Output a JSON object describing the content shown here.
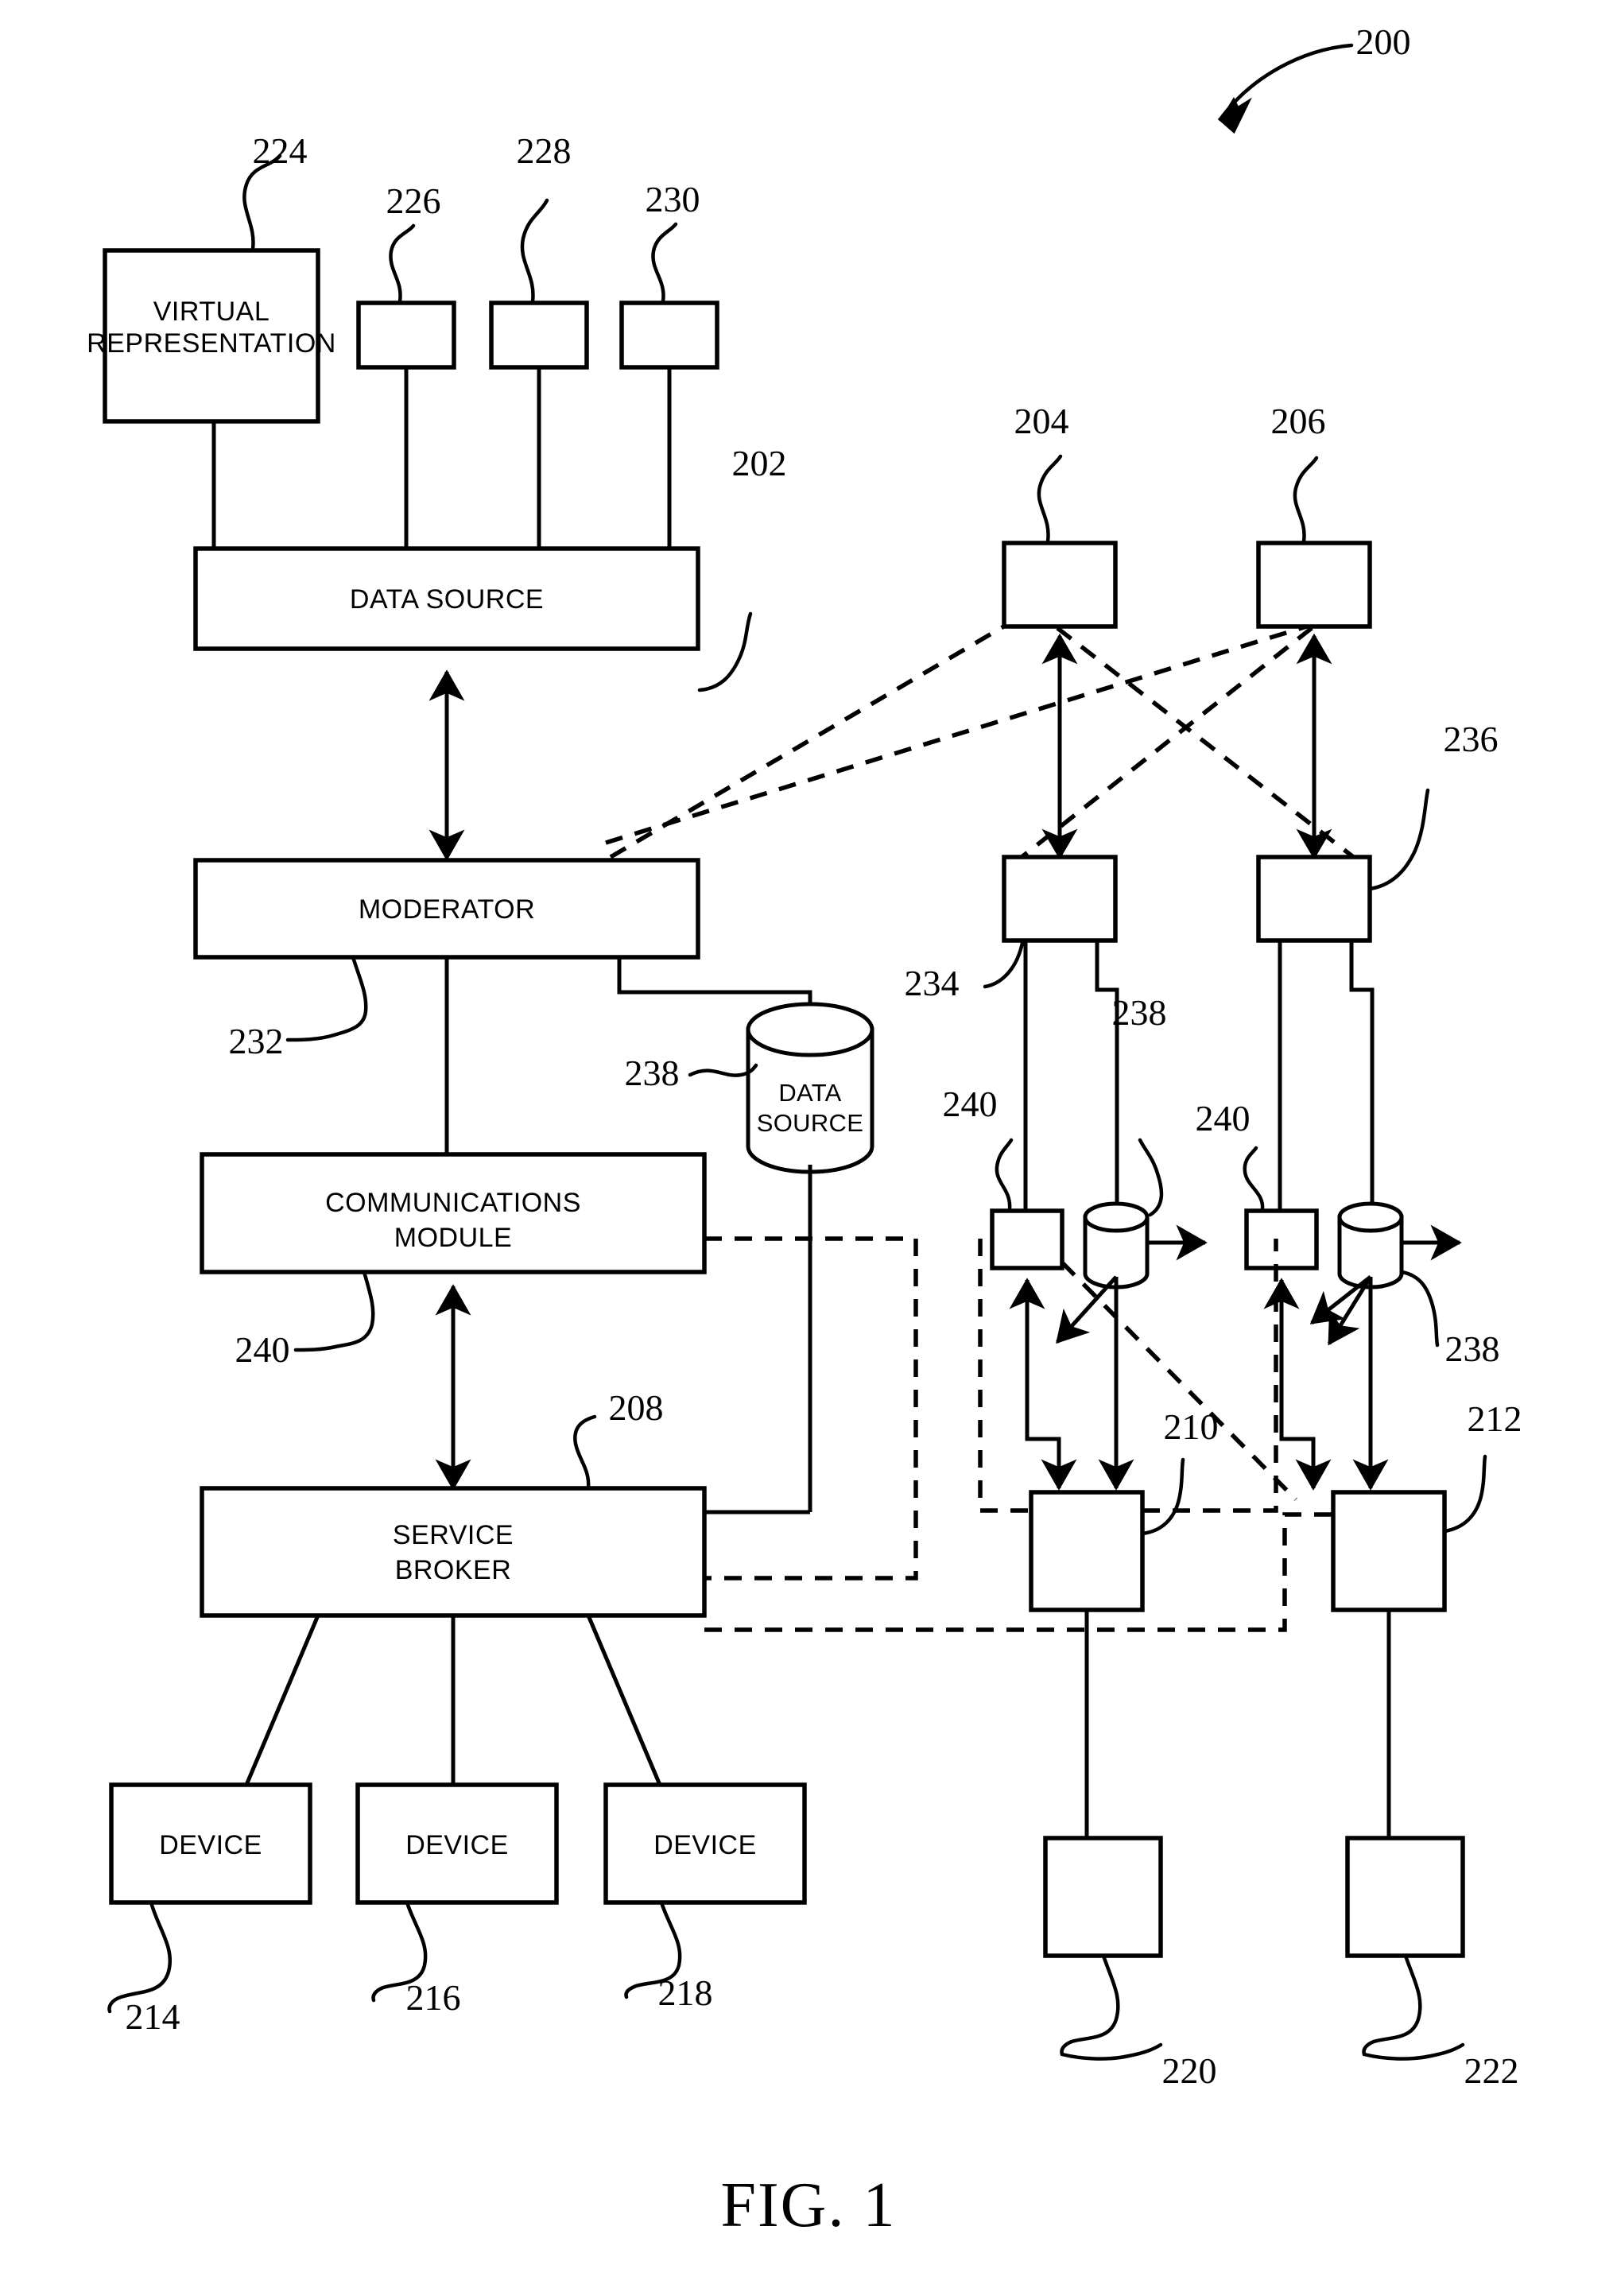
{
  "figure": {
    "caption": "FIG. 1",
    "system_ref": "200"
  },
  "labeled_boxes": [
    {
      "id": "virtual-representation",
      "label_line1": "VIRTUAL",
      "label_line2": "REPRESENTATION",
      "ref": "224"
    },
    {
      "id": "data-source-top",
      "label_line1": "DATA SOURCE",
      "label_line2": "",
      "ref": "202"
    },
    {
      "id": "moderator",
      "label_line1": "MODERATOR",
      "label_line2": "",
      "ref": "232"
    },
    {
      "id": "communications-module",
      "label_line1": "COMMUNICATIONS",
      "label_line2": "MODULE",
      "ref": "240"
    },
    {
      "id": "service-broker",
      "label_line1": "SERVICE",
      "label_line2": "BROKER",
      "ref": "208"
    },
    {
      "id": "data-source-cylinder",
      "label_line1": "DATA",
      "label_line2": "SOURCE",
      "ref": "238"
    }
  ],
  "device_boxes": [
    {
      "label": "DEVICE",
      "ref": "214"
    },
    {
      "label": "DEVICE",
      "ref": "216"
    },
    {
      "label": "DEVICE",
      "ref": "218"
    }
  ],
  "unlabeled_source_boxes": [
    {
      "ref": "226"
    },
    {
      "ref": "228"
    },
    {
      "ref": "230"
    }
  ],
  "right_column_refs": {
    "top_left_node": "204",
    "top_right_node": "206",
    "mid_right_node": "236",
    "mid_left_node_leader": "234",
    "comm_left": "240",
    "comm_right": "240",
    "store_left": "238",
    "store_right": "238",
    "broker_left": "210",
    "broker_right": "212",
    "device_left": "220",
    "device_right": "222"
  },
  "reference_numerals": [
    "200",
    "202",
    "204",
    "206",
    "208",
    "210",
    "212",
    "214",
    "216",
    "218",
    "220",
    "222",
    "224",
    "226",
    "228",
    "230",
    "232",
    "234",
    "236",
    "238",
    "240"
  ],
  "colors": {
    "ink": "#000000",
    "paper": "#ffffff"
  }
}
